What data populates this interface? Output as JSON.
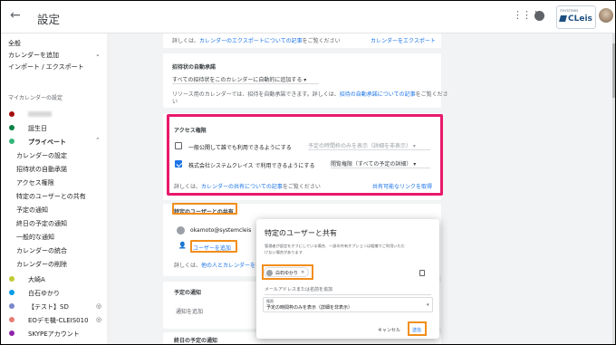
{
  "header": {
    "title": "設定",
    "back_icon": "←",
    "apps_icon": "⋮⋮⋮",
    "logo_sub": "ITSYSTEMIS",
    "logo_text": "CLeis"
  },
  "sidebar": {
    "items_top": [
      "全般",
      "カレンダーを追加",
      "インポート / エクスポート"
    ],
    "section_label": "マイカレンダーの設定",
    "calendars": [
      {
        "label": "",
        "color": "#a50e0e",
        "blurred": true
      },
      {
        "label": "誕生日",
        "color": "#0b8043"
      },
      {
        "label": "プライベート",
        "color": "#33b679"
      }
    ],
    "sub_items": [
      "カレンダーの設定",
      "招待状の自動承諾",
      "アクセス権限",
      "特定のユーザーとの共有",
      "予定の通知",
      "終日の予定の通知",
      "一般的な通知",
      "カレンダーの統合",
      "カレンダーの削除"
    ],
    "other_calendars": [
      {
        "label": "大崎A",
        "color": "#c0ca33"
      },
      {
        "label": "白石ゆかり",
        "color": "#039be5"
      },
      {
        "label": "【テスト】SD",
        "color": "#7986cb"
      },
      {
        "label": "EOデモ機-CLEIS010",
        "color": "#e67c73"
      },
      {
        "label": "SKYPEアカウント",
        "color": "#8e24aa"
      }
    ]
  },
  "export_card": {
    "text": "詳しくは、",
    "link": "カレンダーのエクスポートについての記事",
    "suffix": "をご覧ください",
    "action": "カレンダーをエクスポート"
  },
  "invite_card": {
    "heading": "招待状の自動承諾",
    "select_value": "すべての招待状をこのカレンダーに自動的に追加する",
    "desc": "リソース用のカレンダーでは、招待を自動承諾できます。詳しくは、",
    "link": "招待の自動承諾についての記事",
    "suffix": "をご覧くださ",
    "suffix2": "い"
  },
  "access_card": {
    "heading": "アクセス権限",
    "public_label": "一般公開して誰でも利用できるようにする",
    "public_checked": false,
    "public_select": "予定の時間枠のみを表示（詳細を非表示）",
    "org_label": "株式会社システムクレイス で利用できるようにする",
    "org_checked": true,
    "org_select": "閲覧権限（すべての予定の詳細）",
    "footer_text": "詳しくは、",
    "footer_link": "カレンダーの共有についての記事",
    "footer_suffix": "をご覧ください",
    "share_link": "共有可能なリンクを取得"
  },
  "share_card": {
    "heading": "特定のユーザーとの共有",
    "email": "okamoto@systemcleis",
    "add_button": "ユーザーを追加",
    "footer_text": "詳しくは、",
    "footer_link": "他の人とカレンダーを",
    "footer_suffix": "を"
  },
  "notify_card": {
    "heading": "予定の通知",
    "add": "通知を追加"
  },
  "allday_card": {
    "heading": "終日の予定の通知"
  },
  "dialog": {
    "title": "特定のユーザーと共有",
    "desc1": "管理者が設定をオフにしている場合、一部の共有オプションは組織でご利用いただ",
    "desc2": "けない場合があります",
    "chip_label": "白石ゆかり",
    "chip_close": "✕",
    "input_placeholder": "メールアドレスまたは名前を追加",
    "perm_label": "権限",
    "perm_value": "予定の時間枠のみを表示（詳細を非表示）",
    "cancel": "キャンセル",
    "send": "送信"
  }
}
